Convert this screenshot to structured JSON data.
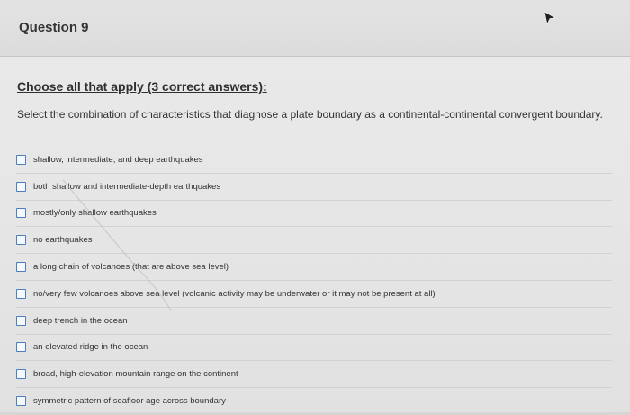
{
  "question": {
    "title": "Question 9",
    "instruction": "Choose all that apply (3 correct answers):",
    "prompt": "Select the combination of characteristics that diagnose a plate boundary as a continental-continental convergent boundary."
  },
  "options": [
    {
      "label": "shallow, intermediate, and deep earthquakes",
      "checked": false
    },
    {
      "label": "both shallow and intermediate-depth earthquakes",
      "checked": false
    },
    {
      "label": "mostly/only shallow earthquakes",
      "checked": false
    },
    {
      "label": "no earthquakes",
      "checked": false
    },
    {
      "label": "a long chain of volcanoes (that are above sea level)",
      "checked": false
    },
    {
      "label": "no/very few volcanoes above sea level (volcanic activity may be underwater or it may not be present at all)",
      "checked": false
    },
    {
      "label": "deep trench in the ocean",
      "checked": false
    },
    {
      "label": "an elevated ridge in the ocean",
      "checked": false
    },
    {
      "label": "broad, high-elevation mountain range on the continent",
      "checked": false
    },
    {
      "label": "symmetric pattern of seafloor age across boundary",
      "checked": false
    }
  ],
  "colors": {
    "checkbox_border": "#4a7fbf",
    "divider": "#d2d2d2"
  }
}
